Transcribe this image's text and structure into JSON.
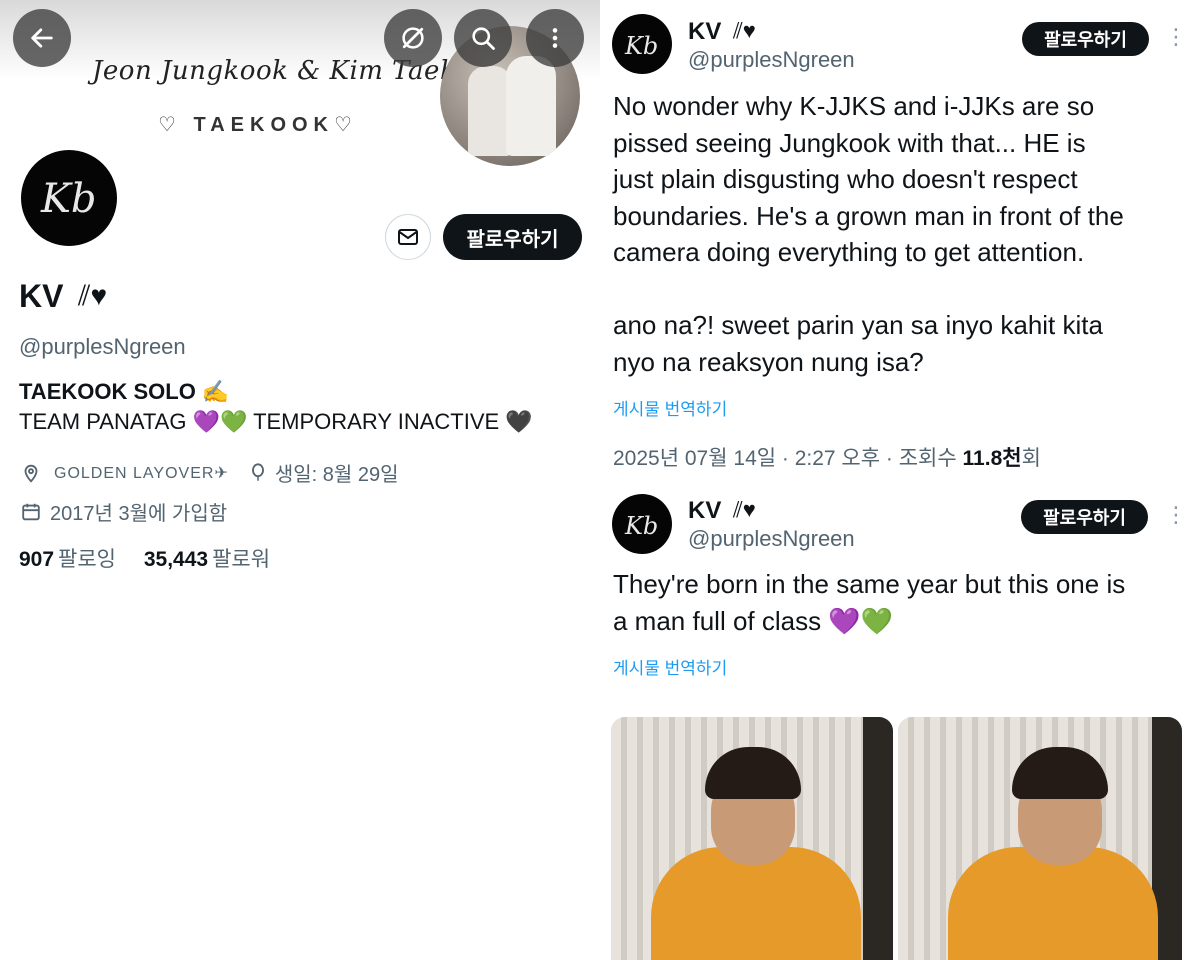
{
  "profile": {
    "banner_script": "Jeon Jungkook & Kim Taehyung",
    "banner_tag": "♡ TAEKOOK♡",
    "name": "KV",
    "name_deco": "⫽♥",
    "handle": "@purplesNgreen",
    "follow_label": "팔로우하기",
    "bio_line1": "TAEKOOK SOLO ✍️",
    "bio_line2": "TEAM PANATAG 💜💚 TEMPORARY INACTIVE 🖤",
    "location": "GOLDEN LAYOVER✈",
    "birthday": "생일: 8월 29일",
    "joined": "2017년 3월에 가입함",
    "following_count": "907",
    "following_label": "팔로잉",
    "followers_count": "35,443",
    "followers_label": "팔로워",
    "avatar_text": "Kb"
  },
  "tweets": [
    {
      "name": "KV",
      "name_deco": "⫽♥",
      "handle": "@purplesNgreen",
      "follow_label": "팔로우하기",
      "more": "⋮",
      "text_line1": "No wonder why K-JJKS and i-JJKs are so",
      "text_line2": "pissed seeing Jungkook with that... HE is",
      "text_line3": "just plain disgusting who doesn't respect",
      "text_line4": "boundaries. He's a grown man in front of the",
      "text_line5": "camera doing everything to get attention.",
      "text_line6": "ano na?! sweet parin yan sa inyo kahit kita",
      "text_line7": "nyo na reaksyon nung isa?",
      "translate": "게시물 번역하기",
      "timestamp_prefix": "2025년 07월 14일 · 2:27 오후 · 조회수 ",
      "views": "11.8천",
      "views_suffix": "회"
    },
    {
      "name": "KV",
      "name_deco": "⫽♥",
      "handle": "@purplesNgreen",
      "follow_label": "팔로우하기",
      "more": "⋮",
      "text_line1": "They're born in the same year but this one is",
      "text_line2": "a man full of class 💜💚",
      "translate": "게시물 번역하기"
    }
  ],
  "colors": {
    "accent_link": "#1d9bf0",
    "button_dark": "#0f1419",
    "secondary_text": "#536471"
  }
}
